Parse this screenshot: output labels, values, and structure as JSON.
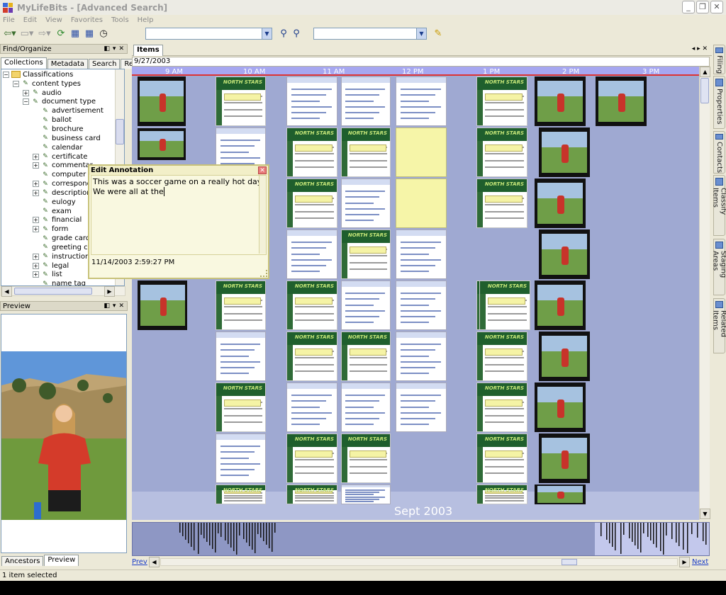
{
  "window": {
    "title": "MyLifeBits - [Advanced Search]",
    "min": "_",
    "restore": "❐",
    "close": "✕"
  },
  "menu": [
    "File",
    "Edit",
    "View",
    "Favorites",
    "Tools",
    "Help"
  ],
  "toolbar": {
    "search_value": "",
    "filter_value": ""
  },
  "find_panel": {
    "title": "Find/Organize",
    "tabs": [
      "Collections",
      "Metadata",
      "Search",
      "Refine"
    ],
    "tree": [
      {
        "label": "Classifications",
        "level": 0,
        "exp": "−",
        "icon": "folder"
      },
      {
        "label": "content types",
        "level": 1,
        "exp": "−",
        "icon": "tag"
      },
      {
        "label": "audio",
        "level": 2,
        "exp": "+",
        "icon": "tag"
      },
      {
        "label": "document type",
        "level": 2,
        "exp": "−",
        "icon": "tag"
      },
      {
        "label": "advertisement",
        "level": 3,
        "exp": "",
        "icon": "tag"
      },
      {
        "label": "ballot",
        "level": 3,
        "exp": "",
        "icon": "tag"
      },
      {
        "label": "brochure",
        "level": 3,
        "exp": "",
        "icon": "tag"
      },
      {
        "label": "business card",
        "level": 3,
        "exp": "",
        "icon": "tag"
      },
      {
        "label": "calendar",
        "level": 3,
        "exp": "",
        "icon": "tag"
      },
      {
        "label": "certificate",
        "level": 3,
        "exp": "+",
        "icon": "tag"
      },
      {
        "label": "commentar",
        "level": 3,
        "exp": "+",
        "icon": "tag"
      },
      {
        "label": "computer s",
        "level": 3,
        "exp": "",
        "icon": "tag"
      },
      {
        "label": "correspond",
        "level": 3,
        "exp": "+",
        "icon": "tag"
      },
      {
        "label": "description",
        "level": 3,
        "exp": "+",
        "icon": "tag"
      },
      {
        "label": "eulogy",
        "level": 3,
        "exp": "",
        "icon": "tag"
      },
      {
        "label": "exam",
        "level": 3,
        "exp": "",
        "icon": "tag"
      },
      {
        "label": "financial",
        "level": 3,
        "exp": "+",
        "icon": "tag"
      },
      {
        "label": "form",
        "level": 3,
        "exp": "+",
        "icon": "tag"
      },
      {
        "label": "grade card",
        "level": 3,
        "exp": "",
        "icon": "tag"
      },
      {
        "label": "greeting ca",
        "level": 3,
        "exp": "",
        "icon": "tag"
      },
      {
        "label": "instructions",
        "level": 3,
        "exp": "+",
        "icon": "tag"
      },
      {
        "label": "legal",
        "level": 3,
        "exp": "+",
        "icon": "tag"
      },
      {
        "label": "list",
        "level": 3,
        "exp": "+",
        "icon": "tag"
      },
      {
        "label": "name tag",
        "level": 3,
        "exp": "",
        "icon": "tag"
      }
    ]
  },
  "preview_panel": {
    "title": "Preview",
    "bottom_tabs": [
      "Ancestors",
      "Preview"
    ]
  },
  "items_panel": {
    "title": "Items",
    "date": "9/27/2003",
    "hours": [
      "9 AM",
      "10 AM",
      "11 AM",
      "12 PM",
      "1 PM",
      "2 PM",
      "3 PM"
    ],
    "month_label": "Sept 2003",
    "thumb_banner": "NORTH STARS"
  },
  "annotation": {
    "title": "Edit Annotation",
    "text": "This was a soccer game on a really hot day. We were all at the",
    "timestamp": "11/14/2003 2:59:27 PM"
  },
  "right_tabs": [
    "Filing",
    "Properties",
    "Contacts",
    "Classify Items",
    "Staging Areas",
    "Related Items"
  ],
  "nav": {
    "prev": "Prev",
    "next": "Next"
  },
  "status": {
    "text": "1 item selected"
  },
  "colors": {
    "accent": "#1a3cc8",
    "timeline": "#9fa9d2",
    "ruler": "#a6a7f0"
  }
}
